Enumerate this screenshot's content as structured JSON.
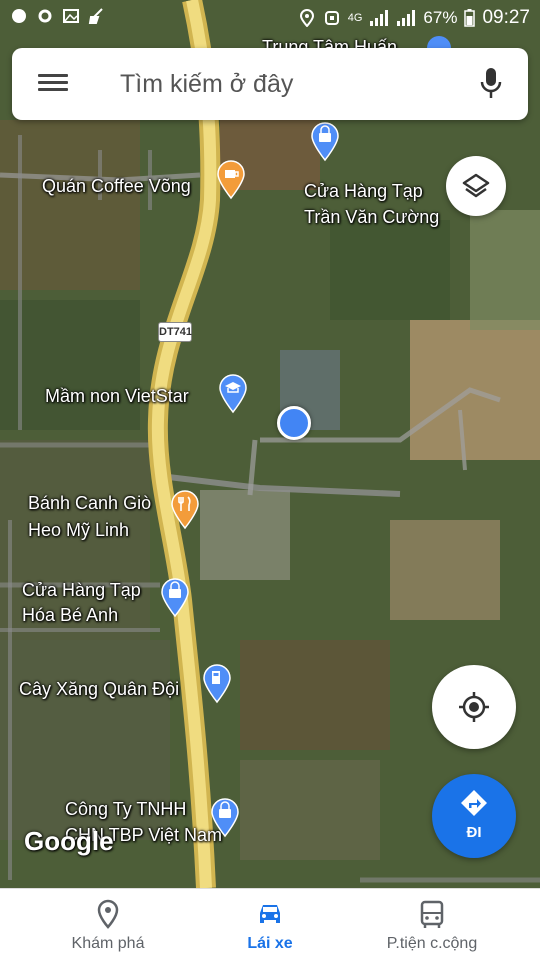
{
  "status_bar": {
    "network": "4G",
    "battery": "67%",
    "time": "09:27"
  },
  "search": {
    "placeholder": "Tìm kiếm ở đây",
    "menu_icon": "hamburger-menu-icon",
    "mic_icon": "microphone-icon"
  },
  "map": {
    "road_label": "DT741",
    "places": [
      {
        "name": "Trung Tâm Huấn",
        "icon": "landmark-icon"
      },
      {
        "name": "Quán Coffee Võng",
        "icon": "coffee-icon"
      },
      {
        "name": "Cửa Hàng Tạp\nTrần Văn Cường",
        "icon": "shopping-bag-icon"
      },
      {
        "name": "Mầm non VietStar",
        "icon": "school-icon"
      },
      {
        "name": "Bánh Canh Giò\nHeo Mỹ Linh",
        "icon": "restaurant-icon"
      },
      {
        "name": "Cửa Hàng Tạp\nHóa Bé Anh",
        "icon": "shopping-bag-icon"
      },
      {
        "name": "Cây Xăng Quân Đội",
        "icon": "gas-station-icon"
      },
      {
        "name": "Công Ty TNHH\nCHN TBP Việt Nam",
        "icon": "shopping-bag-icon"
      }
    ],
    "attribution": "Google"
  },
  "buttons": {
    "layers": "layers-icon",
    "my_location": "my-location-icon",
    "directions_label": "ĐI"
  },
  "nav": {
    "tabs": [
      {
        "label": "Khám phá",
        "icon": "explore-pin-icon",
        "active": false
      },
      {
        "label": "Lái xe",
        "icon": "car-icon",
        "active": true
      },
      {
        "label": "P.tiện c.cộng",
        "icon": "bus-icon",
        "active": false
      }
    ]
  },
  "colors": {
    "accent": "#1a73e8",
    "place_pin_blue": "#4f8ef7",
    "place_pin_orange": "#f39c3a",
    "location_dot": "#4285f4"
  }
}
